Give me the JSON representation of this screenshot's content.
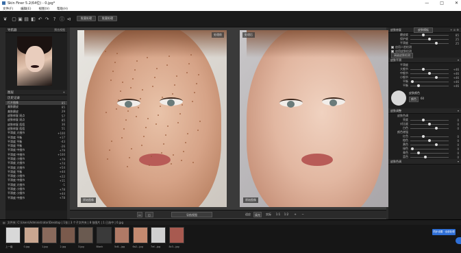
{
  "window": {
    "title": "Skin Finer 5.2(64位) - 0.jpg*",
    "min": "—",
    "max": "□",
    "close": "✕"
  },
  "menu": [
    "文件(F)",
    "编辑(E)",
    "视图(V)",
    "帮助(H)"
  ],
  "toolbar": {
    "btn1": "批量处理",
    "btn2": "批量处理"
  },
  "left": {
    "nav_title": "导航器",
    "nav_right": "预览视图",
    "layers_title": "图层",
    "history_title": "历史记录",
    "history": [
      {
        "label": "打开图像",
        "value": "85"
      },
      {
        "label": "美肤磨皮",
        "value": "85"
      },
      {
        "label": "美肤磨皮",
        "value": "29"
      },
      {
        "label": "皮肤修复 斑点",
        "value": "57"
      },
      {
        "label": "皮肤修复 斑点",
        "value": "85"
      },
      {
        "label": "皮肤修复 痘痘",
        "value": "36"
      },
      {
        "label": "皮肤修复 痘痘",
        "value": "51"
      },
      {
        "label": "平滑度 大细节",
        "value": "+100"
      },
      {
        "label": "平滑度 平衡",
        "value": "+17"
      },
      {
        "label": "平滑度 平衡",
        "value": "-43"
      },
      {
        "label": "平滑度 平衡",
        "value": "-26"
      },
      {
        "label": "平滑度 中细节",
        "value": "+79"
      },
      {
        "label": "平滑度 中细节",
        "value": "+100"
      },
      {
        "label": "平滑度 小细节",
        "value": "+79"
      },
      {
        "label": "平滑度 大细节",
        "value": "+74"
      },
      {
        "label": "平滑度 大细节",
        "value": "+54"
      },
      {
        "label": "平滑度 平衡",
        "value": "+44"
      },
      {
        "label": "平滑度 小细节",
        "value": "+22"
      },
      {
        "label": "平滑度 中细节",
        "value": "+11"
      },
      {
        "label": "平滑度 大细节",
        "value": "-1"
      },
      {
        "label": "平滑度 小细节",
        "value": "+78"
      },
      {
        "label": "平滑度 小细节",
        "value": "+44"
      },
      {
        "label": "平滑度 中细节",
        "value": "+78"
      }
    ]
  },
  "viewer": {
    "left_label": "处理前",
    "right_label": "处理后",
    "left_cap": "原始图像",
    "right_cap": "原始图像",
    "bar": {
      "preview": "导航视图",
      "fit": "适应",
      "fill": "填充",
      "actual": "实际",
      "zoom": "1:1",
      "zoom2": "1:2"
    }
  },
  "right": {
    "preset_label": "皮肤修复",
    "preset_dd": "皮肤模板",
    "rows1": [
      {
        "label": "磨皮度",
        "value": "85"
      },
      {
        "label": "保护度",
        "value": "25"
      },
      {
        "label": "平滑度",
        "value": "25"
      }
    ],
    "check1": "启用人脸检测",
    "check2": "启用皮肤检测",
    "btn_detect": "高级皮肤检测",
    "sect2": "皮肤平滑",
    "sect2_sub": "平滑度",
    "rows2": [
      {
        "label": "大细节",
        "value": "+46"
      },
      {
        "label": "中细节",
        "value": "+46"
      },
      {
        "label": "小细节",
        "value": "+46"
      },
      {
        "label": "平衡",
        "value": "+46"
      },
      {
        "label": "平衡",
        "value": "+46"
      }
    ],
    "color_label": "皮肤颜色",
    "color_btn": "颜色",
    "color_val": "60",
    "sect3": "皮肤调整",
    "sect3_sub": "皮肤色调",
    "rows3": [
      {
        "label": "亮度",
        "value": "0"
      },
      {
        "label": "对比度",
        "value": "0"
      },
      {
        "label": "白色",
        "value": "0"
      }
    ],
    "sect3_sub2": "颜色增强",
    "rows4": [
      {
        "label": "红色",
        "value": "0"
      },
      {
        "label": "橙色",
        "value": "0"
      },
      {
        "label": "黄色",
        "value": "0"
      },
      {
        "label": "绿色",
        "value": "0"
      },
      {
        "label": "青色",
        "value": "0"
      },
      {
        "label": "蓝色",
        "value": "0"
      }
    ],
    "sect4": "皮肤色调"
  },
  "filmstrip": {
    "path": "文件夹: C:\\Users\\Administrator\\Desktop | 1张 | 3 个子文件夹 | 8 张图片 | 1 已选中 | 0.jpg",
    "items": [
      "上一级",
      "0.jpg",
      "1.jpg",
      "2.jpg",
      "3.jpg",
      "Blank",
      "5c8...jpg",
      "6a2...jpg",
      "7ef...jpg",
      "8c3...jpg"
    ],
    "blue_btn": "同步设置 · 全部处理"
  }
}
